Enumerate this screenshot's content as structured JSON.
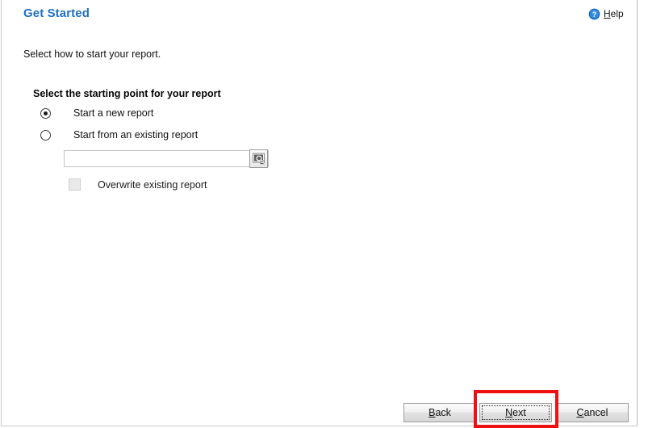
{
  "window": {
    "title": "Get Started",
    "title_color": "#1f6fc4",
    "background_color": "#ffffff"
  },
  "header": {
    "title": "Get Started",
    "help": {
      "label_first_letter": "H",
      "label_rest": "elp",
      "label_full": "Help",
      "icon": "help-circle-icon",
      "icon_color": "#1f6fc4"
    }
  },
  "main": {
    "intro_text": "Select how to start your report.",
    "group_label": "Select the starting point for your report",
    "radio_options": [
      {
        "label": "Start a new report",
        "selected": true
      },
      {
        "label": "Start from an existing report",
        "selected": false
      }
    ],
    "existing_report_picker": {
      "value": "",
      "placeholder": "",
      "browse_icon": "browse-search-icon",
      "enabled": false
    },
    "overwrite_checkbox": {
      "label": "Overwrite existing report",
      "checked": false,
      "enabled": false
    }
  },
  "footer": {
    "buttons": [
      {
        "label": "Back",
        "accel": "B",
        "rest": "ack",
        "focused": false,
        "highlighted": false
      },
      {
        "label": "Next",
        "accel": "N",
        "rest": "ext",
        "focused": true,
        "highlighted": true
      },
      {
        "label": "Cancel",
        "accel": "C",
        "rest": "ancel",
        "focused": false,
        "highlighted": false
      }
    ]
  },
  "annotation": {
    "type": "rectangle",
    "color": "#ee1111",
    "target": "Next"
  }
}
